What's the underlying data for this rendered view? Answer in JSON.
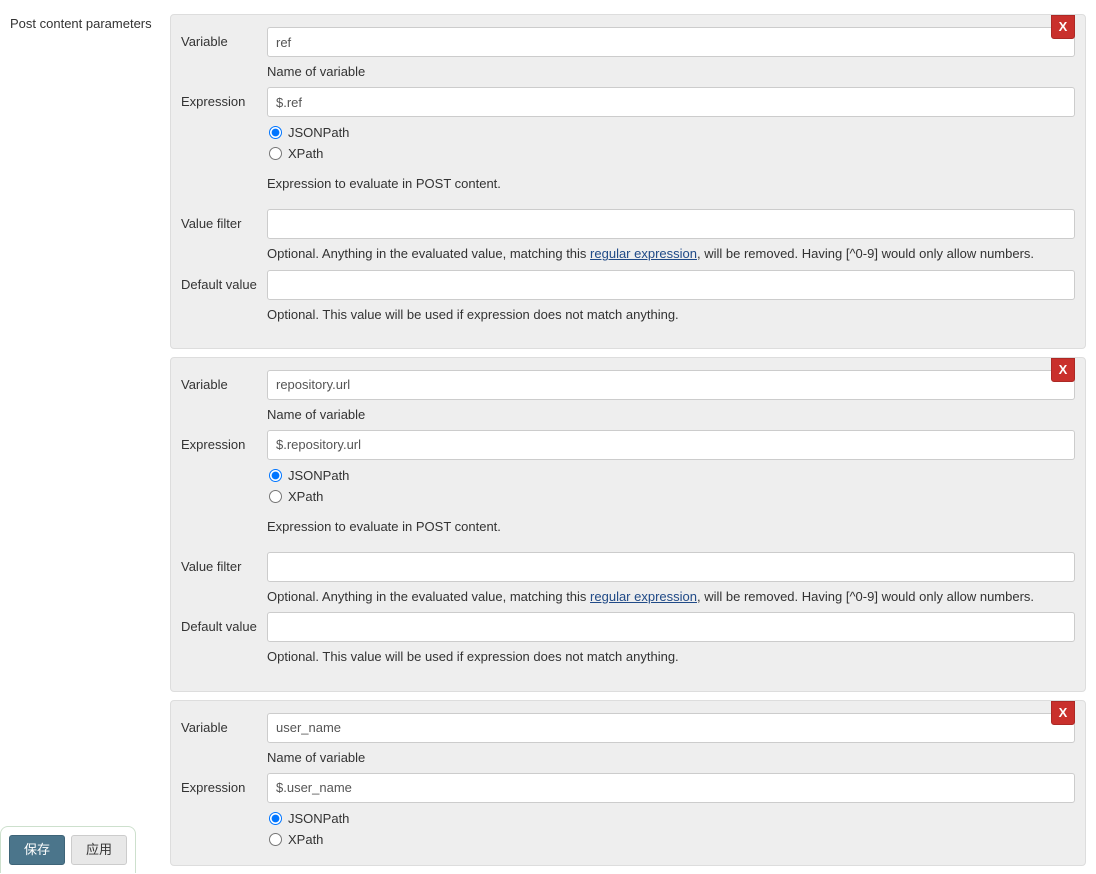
{
  "section_title": "Post content parameters",
  "labels": {
    "variable": "Variable",
    "expression": "Expression",
    "value_filter": "Value filter",
    "default_value": "Default value",
    "jsonpath": "JSONPath",
    "xpath": "XPath"
  },
  "help": {
    "name_of_variable": "Name of variable",
    "expression_eval": "Expression to evaluate in POST content.",
    "value_filter_prefix": "Optional. Anything in the evaluated value, matching this ",
    "regex_link": "regular expression",
    "value_filter_suffix": ", will be removed. Having [^0-9] would only allow numbers.",
    "default_value": "Optional. This value will be used if expression does not match anything."
  },
  "delete_btn": "X",
  "footer": {
    "save": "保存",
    "apply": "应用"
  },
  "params": [
    {
      "variable": "ref",
      "expression": "$.ref",
      "expr_type": "JSONPath",
      "value_filter": "",
      "default_value": ""
    },
    {
      "variable": "repository.url",
      "expression": "$.repository.url",
      "expr_type": "JSONPath",
      "value_filter": "",
      "default_value": ""
    },
    {
      "variable": "user_name",
      "expression": "$.user_name",
      "expr_type": "JSONPath",
      "value_filter": "",
      "default_value": ""
    }
  ]
}
